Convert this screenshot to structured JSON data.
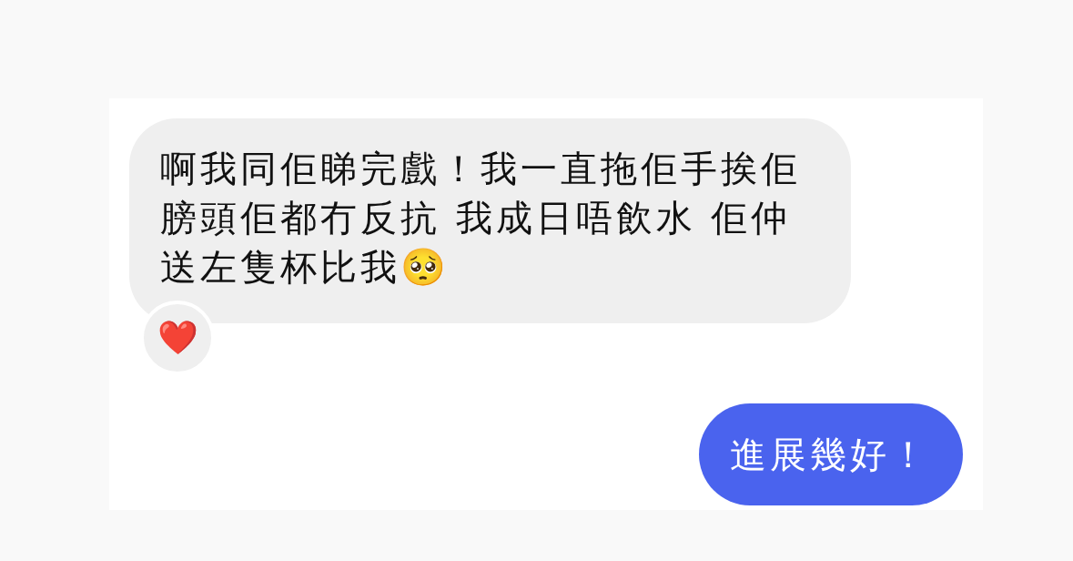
{
  "messages": [
    {
      "kind": "received",
      "text": "啊我同佢睇完戲！我一直拖佢手挨佢膀頭佢都冇反抗 我成日唔飲水 佢仲送左隻杯比我🥺",
      "reaction": "❤️"
    },
    {
      "kind": "sent",
      "text": "進展幾好！"
    }
  ]
}
